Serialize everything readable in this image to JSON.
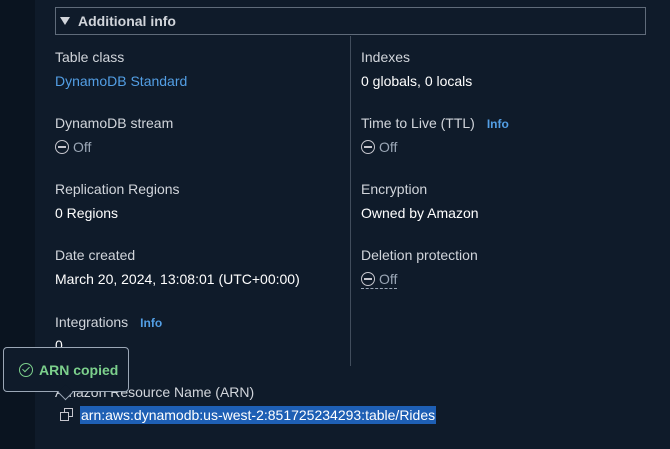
{
  "section": {
    "title": "Additional info"
  },
  "left_column": [
    {
      "label": "Table class",
      "value": "DynamoDB Standard"
    },
    {
      "label": "DynamoDB stream",
      "value": "Off"
    },
    {
      "label": "Replication Regions",
      "value": "0 Regions"
    },
    {
      "label": "Date created",
      "value": "March 20, 2024, 13:08:01 (UTC+00:00)"
    },
    {
      "label": "Integrations",
      "info": "Info",
      "value": "0"
    }
  ],
  "right_column": [
    {
      "label": "Indexes",
      "value": "0 globals, 0 locals"
    },
    {
      "label": "Time to Live (TTL)",
      "info": "Info",
      "value": "Off"
    },
    {
      "label": "Encryption",
      "value": "Owned by Amazon"
    },
    {
      "label": "Deletion protection",
      "value": "Off"
    }
  ],
  "arn": {
    "label": "Amazon Resource Name (ARN)",
    "value": "arn:aws:dynamodb:us-west-2:851725234293:table/Rides"
  },
  "toast": {
    "text": "ARN copied"
  },
  "icons": {
    "caret": "caret-down-icon",
    "status_off": "status-off-icon",
    "success": "check-circle-icon",
    "copy": "copy-icon"
  },
  "colors": {
    "background": "#0f1b2a",
    "link": "#539fe5",
    "success": "#7cd08c",
    "selection": "#1e5fb4",
    "border": "#5f6b7a"
  }
}
